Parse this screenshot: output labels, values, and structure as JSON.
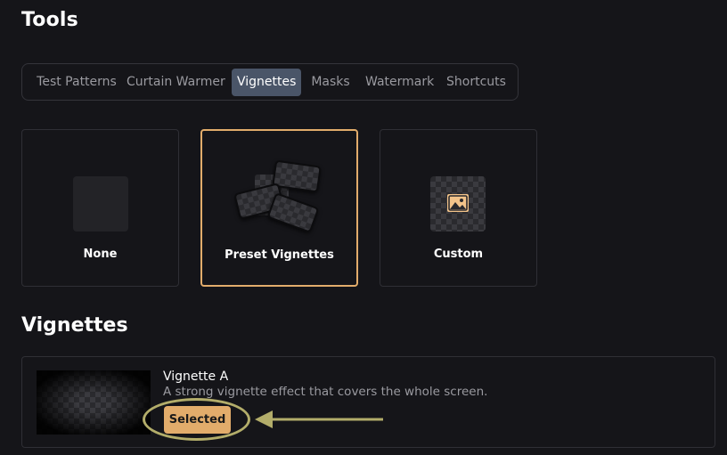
{
  "page": {
    "title": "Tools"
  },
  "tabs": [
    {
      "label": "Test Patterns",
      "active": false
    },
    {
      "label": "Curtain Warmer",
      "active": false
    },
    {
      "label": "Vignettes",
      "active": true
    },
    {
      "label": "Masks",
      "active": false
    },
    {
      "label": "Watermark",
      "active": false
    },
    {
      "label": "Shortcuts",
      "active": false
    }
  ],
  "options": [
    {
      "label": "None",
      "icon": "blank-thumbnail",
      "selected": false
    },
    {
      "label": "Preset Vignettes",
      "icon": "stacked-vignettes-icon",
      "selected": true
    },
    {
      "label": "Custom",
      "icon": "image-icon",
      "selected": false
    }
  ],
  "vignettes": {
    "title": "Vignettes",
    "items": [
      {
        "name": "Vignette A",
        "description": "A strong vignette effect that covers the whole screen.",
        "button_label": "Selected"
      }
    ]
  },
  "colors": {
    "background": "#151519",
    "accent": "#e2ac6b",
    "active_tab": "#4a5568",
    "annotation": "#b3ad6a"
  }
}
